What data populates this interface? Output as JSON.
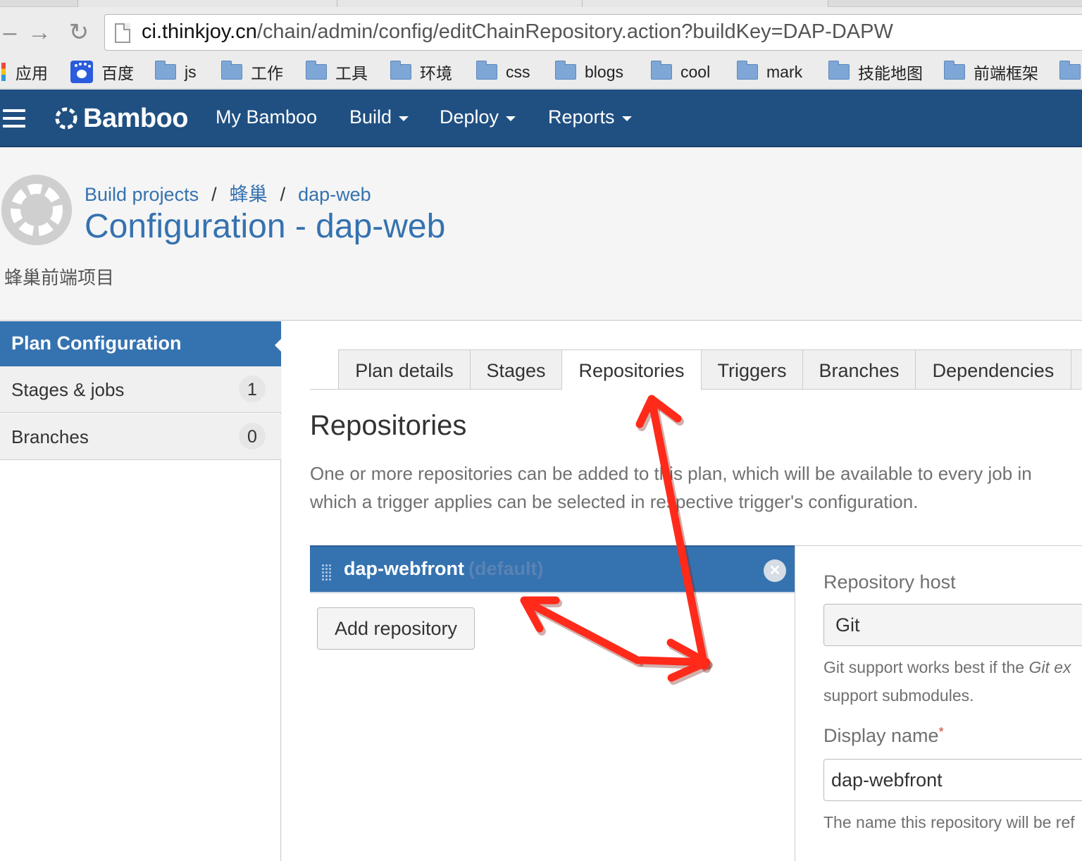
{
  "browser": {
    "url_host": "ci.thinkjoy.cn",
    "url_path": "/chain/admin/config/editChainRepository.action?buildKey=DAP-DAPW",
    "bookmarks": [
      {
        "label": "应用",
        "icon": "apps-icon"
      },
      {
        "label": "百度",
        "icon": "baidu-paw-icon"
      },
      {
        "label": "js",
        "icon": "folder-icon"
      },
      {
        "label": "工作",
        "icon": "folder-icon"
      },
      {
        "label": "工具",
        "icon": "folder-icon"
      },
      {
        "label": "环境",
        "icon": "folder-icon"
      },
      {
        "label": "css",
        "icon": "folder-icon"
      },
      {
        "label": "blogs",
        "icon": "folder-icon"
      },
      {
        "label": "cool",
        "icon": "folder-icon"
      },
      {
        "label": "mark",
        "icon": "folder-icon"
      },
      {
        "label": "技能地图",
        "icon": "folder-icon"
      },
      {
        "label": "前端框架",
        "icon": "folder-icon"
      }
    ]
  },
  "header": {
    "logo": "Bamboo",
    "nav": [
      {
        "label": "My Bamboo",
        "dropdown": false
      },
      {
        "label": "Build",
        "dropdown": true
      },
      {
        "label": "Deploy",
        "dropdown": true
      },
      {
        "label": "Reports",
        "dropdown": true
      }
    ],
    "brand_color": "#205081"
  },
  "page": {
    "breadcrumb": [
      "Build projects",
      "蜂巢",
      "dap-web"
    ],
    "title": "Configuration - dap-web",
    "description": "蜂巢前端项目"
  },
  "sidebar": {
    "heading": "Plan Configuration",
    "items": [
      {
        "label": "Stages & jobs",
        "count": "1"
      },
      {
        "label": "Branches",
        "count": "0"
      }
    ]
  },
  "tabs": [
    "Plan details",
    "Stages",
    "Repositories",
    "Triggers",
    "Branches",
    "Dependencies"
  ],
  "active_tab": "Repositories",
  "repositories": {
    "title": "Repositories",
    "intro_line1": "One or more repositories can be added to this plan, which will be available to every job in",
    "intro_line2": "which a trigger applies can be selected in respective trigger's configuration.",
    "items": [
      {
        "name": "dap-webfront",
        "tag": "(default)"
      }
    ],
    "add_button": "Add repository"
  },
  "form": {
    "host_label": "Repository host",
    "host_value": "Git",
    "host_help_1a": "Git support works best if the ",
    "host_help_1b": "Git ex",
    "host_help_2": "support submodules.",
    "display_name_label": "Display name",
    "display_name_required": "*",
    "display_name_value": "dap-webfront",
    "display_name_help": "The name this repository will be ref"
  },
  "colors": {
    "accent": "#3572b0",
    "annotation": "#ff2a1a"
  }
}
